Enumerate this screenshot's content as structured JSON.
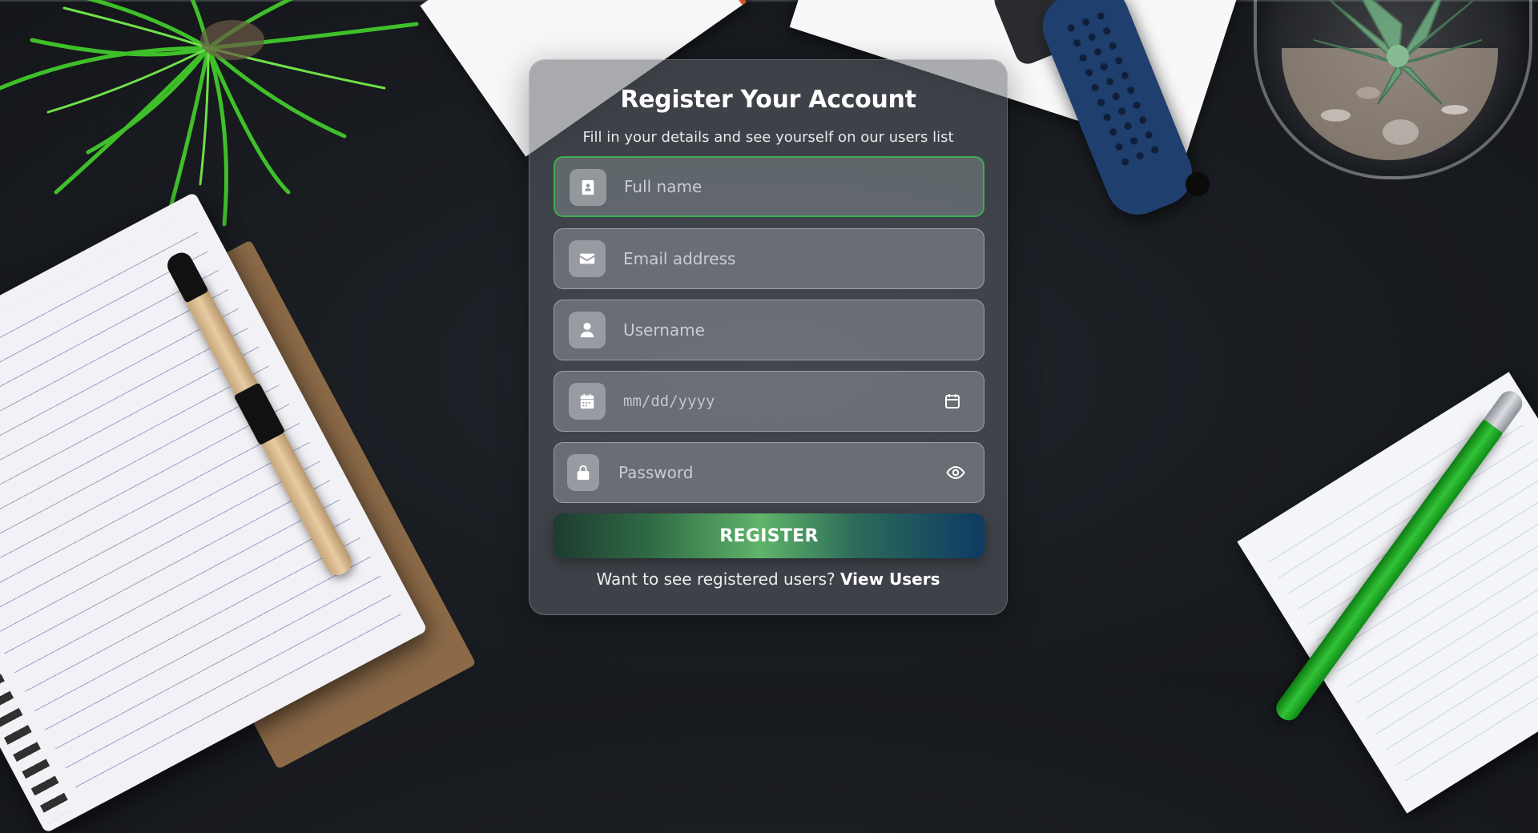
{
  "form": {
    "title": "Register Your Account",
    "subtitle": "Fill in your details and see yourself on our users list",
    "fields": [
      {
        "placeholder": "Full name",
        "icon": "id-card-icon",
        "active": true
      },
      {
        "placeholder": "Email address",
        "icon": "envelope-icon"
      },
      {
        "placeholder": "Username",
        "icon": "user-icon"
      },
      {
        "placeholder": "mm/dd/yyyy",
        "icon": "calendar-icon",
        "trailing_icon": "calendar-picker-icon"
      },
      {
        "placeholder": "Password",
        "icon": "lock-icon",
        "trailing_icon": "eye-icon"
      }
    ],
    "register_label": "REGISTER",
    "footer_text": "Want to see registered users?",
    "footer_link": "View Users"
  },
  "colors": {
    "active_border": "#3fae4f",
    "button_gradient": [
      "#1e3b30",
      "#5fb46a",
      "#0d3a63"
    ]
  }
}
